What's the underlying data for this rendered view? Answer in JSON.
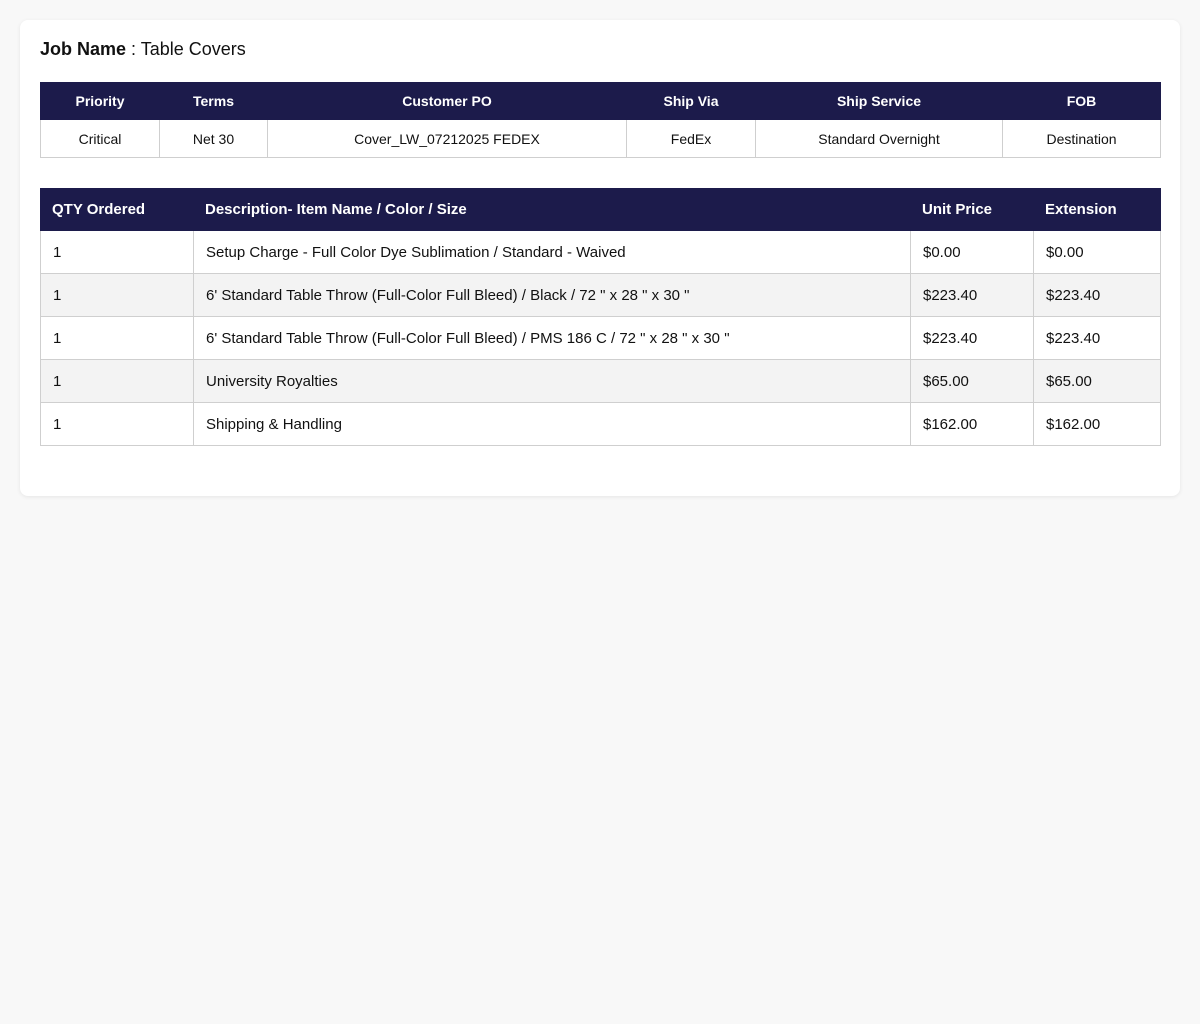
{
  "job": {
    "label": "Job Name",
    "separator": " : ",
    "value": "Table Covers"
  },
  "meta": {
    "headers": [
      "Priority",
      "Terms",
      "Customer PO",
      "Ship Via",
      "Ship Service",
      "FOB"
    ],
    "values": [
      "Critical",
      "Net 30",
      "Cover_LW_07212025 FEDEX",
      "FedEx",
      "Standard Overnight",
      "Destination"
    ]
  },
  "items": {
    "headers": [
      "QTY Ordered",
      "Description- Item Name / Color / Size",
      "Unit Price",
      "Extension"
    ],
    "rows": [
      {
        "qty": "1",
        "description": "Setup Charge - Full Color Dye Sublimation / Standard - Waived",
        "unit_price": "$0.00",
        "extension": "$0.00"
      },
      {
        "qty": "1",
        "description": "6' Standard Table Throw (Full-Color Full Bleed) / Black / 72 \" x 28 \" x 30 \"",
        "unit_price": "$223.40",
        "extension": "$223.40"
      },
      {
        "qty": "1",
        "description": "6' Standard Table Throw (Full-Color Full Bleed) / PMS 186 C / 72 \" x 28 \" x 30 \"",
        "unit_price": "$223.40",
        "extension": "$223.40"
      },
      {
        "qty": "1",
        "description": "University Royalties",
        "unit_price": "$65.00",
        "extension": "$65.00"
      },
      {
        "qty": "1",
        "description": "Shipping & Handling",
        "unit_price": "$162.00",
        "extension": "$162.00"
      }
    ]
  },
  "colors": {
    "header_bg": "#1c1b4b",
    "page_bg": "#f8f8f8",
    "alt_row_bg": "#f3f3f3"
  }
}
